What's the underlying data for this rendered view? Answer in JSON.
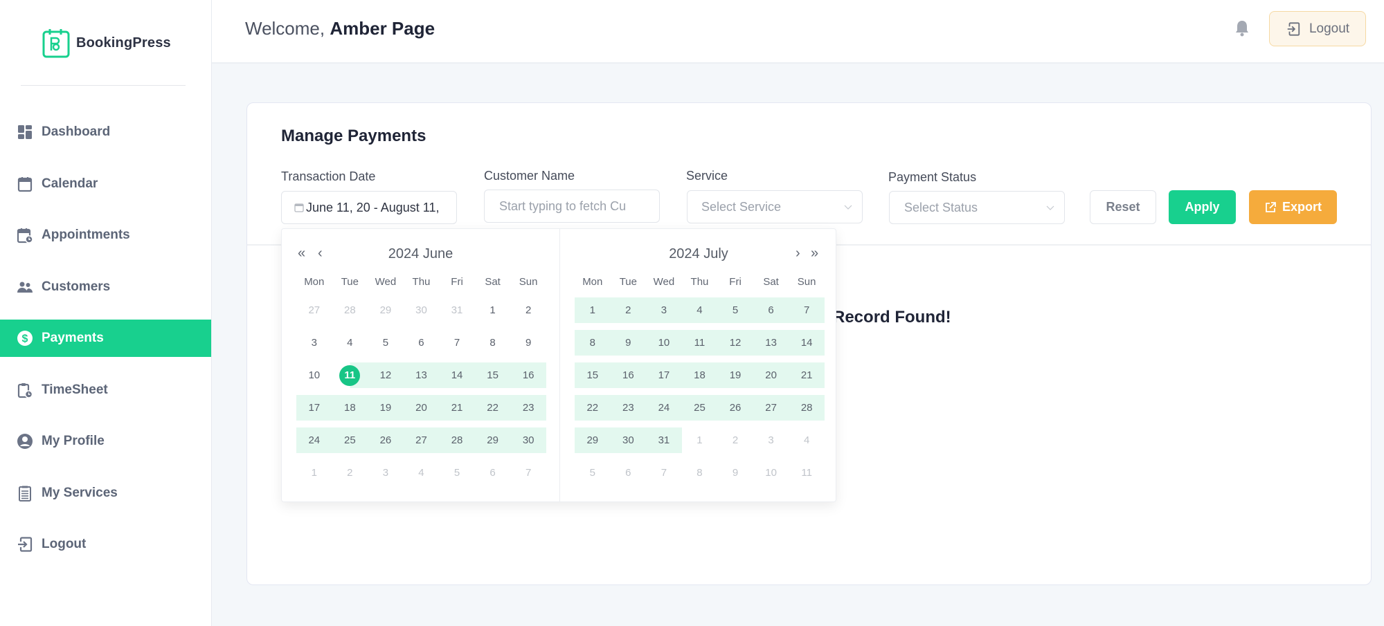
{
  "app": {
    "brand": "BookingPress"
  },
  "sidebar": {
    "items": [
      {
        "label": "Dashboard",
        "icon": "dashboard-icon",
        "active": false
      },
      {
        "label": "Calendar",
        "icon": "calendar-icon",
        "active": false
      },
      {
        "label": "Appointments",
        "icon": "appointments-icon",
        "active": false
      },
      {
        "label": "Customers",
        "icon": "customers-icon",
        "active": false
      },
      {
        "label": "Payments",
        "icon": "dollar-icon",
        "active": true
      },
      {
        "label": "TimeSheet",
        "icon": "timesheet-icon",
        "active": false
      },
      {
        "label": "My Profile",
        "icon": "user-icon",
        "active": false
      },
      {
        "label": "My Services",
        "icon": "services-icon",
        "active": false
      },
      {
        "label": "Logout",
        "icon": "logout-icon",
        "active": false
      }
    ]
  },
  "header": {
    "welcome_prefix": "Welcome,",
    "user_name": "Amber Page",
    "logout_label": "Logout"
  },
  "colors": {
    "accent": "#18d08e",
    "export": "#f5ab3c",
    "range": "#e3f8ef"
  },
  "main": {
    "title": "Manage Payments",
    "filters": {
      "transaction_date": {
        "label": "Transaction Date",
        "value": "June 11, 20 -  August 11,"
      },
      "customer_name": {
        "label": "Customer Name",
        "placeholder": "Start typing to fetch Cu"
      },
      "service": {
        "label": "Service",
        "placeholder": "Select Service"
      },
      "payment_status": {
        "label": "Payment Status",
        "placeholder": "Select Status"
      }
    },
    "buttons": {
      "reset": "Reset",
      "apply": "Apply",
      "export": "Export"
    },
    "empty_message": "Record Found!"
  },
  "datepicker": {
    "weekdays": [
      "Mon",
      "Tue",
      "Wed",
      "Thu",
      "Fri",
      "Sat",
      "Sun"
    ],
    "left": {
      "title": "2024 June",
      "weeks": [
        [
          [
            "27",
            "m"
          ],
          [
            "28",
            "m"
          ],
          [
            "29",
            "m"
          ],
          [
            "30",
            "m"
          ],
          [
            "31",
            "m"
          ],
          [
            "1",
            ""
          ],
          [
            "2",
            ""
          ]
        ],
        [
          [
            "3",
            ""
          ],
          [
            "4",
            ""
          ],
          [
            "5",
            ""
          ],
          [
            "6",
            ""
          ],
          [
            "7",
            ""
          ],
          [
            "8",
            ""
          ],
          [
            "9",
            ""
          ]
        ],
        [
          [
            "10",
            ""
          ],
          [
            "11",
            "s"
          ],
          [
            "12",
            "r"
          ],
          [
            "13",
            "r"
          ],
          [
            "14",
            "r"
          ],
          [
            "15",
            "r"
          ],
          [
            "16",
            "r"
          ]
        ],
        [
          [
            "17",
            "r"
          ],
          [
            "18",
            "r"
          ],
          [
            "19",
            "r"
          ],
          [
            "20",
            "r"
          ],
          [
            "21",
            "r"
          ],
          [
            "22",
            "r"
          ],
          [
            "23",
            "r"
          ]
        ],
        [
          [
            "24",
            "r"
          ],
          [
            "25",
            "r"
          ],
          [
            "26",
            "r"
          ],
          [
            "27",
            "r"
          ],
          [
            "28",
            "r"
          ],
          [
            "29",
            "r"
          ],
          [
            "30",
            "r"
          ]
        ],
        [
          [
            "1",
            "m"
          ],
          [
            "2",
            "m"
          ],
          [
            "3",
            "m"
          ],
          [
            "4",
            "m"
          ],
          [
            "5",
            "m"
          ],
          [
            "6",
            "m"
          ],
          [
            "7",
            "m"
          ]
        ]
      ]
    },
    "right": {
      "title": "2024 July",
      "weeks": [
        [
          [
            "1",
            "r"
          ],
          [
            "2",
            "r"
          ],
          [
            "3",
            "r"
          ],
          [
            "4",
            "r"
          ],
          [
            "5",
            "r"
          ],
          [
            "6",
            "r"
          ],
          [
            "7",
            "r"
          ]
        ],
        [
          [
            "8",
            "r"
          ],
          [
            "9",
            "r"
          ],
          [
            "10",
            "r"
          ],
          [
            "11",
            "r"
          ],
          [
            "12",
            "r"
          ],
          [
            "13",
            "r"
          ],
          [
            "14",
            "r"
          ]
        ],
        [
          [
            "15",
            "r"
          ],
          [
            "16",
            "r"
          ],
          [
            "17",
            "r"
          ],
          [
            "18",
            "r"
          ],
          [
            "19",
            "r"
          ],
          [
            "20",
            "r"
          ],
          [
            "21",
            "r"
          ]
        ],
        [
          [
            "22",
            "r"
          ],
          [
            "23",
            "r"
          ],
          [
            "24",
            "r"
          ],
          [
            "25",
            "r"
          ],
          [
            "26",
            "r"
          ],
          [
            "27",
            "r"
          ],
          [
            "28",
            "r"
          ]
        ],
        [
          [
            "29",
            "r"
          ],
          [
            "30",
            "r"
          ],
          [
            "31",
            "r"
          ],
          [
            "1",
            "m"
          ],
          [
            "2",
            "m"
          ],
          [
            "3",
            "m"
          ],
          [
            "4",
            "m"
          ]
        ],
        [
          [
            "5",
            "m"
          ],
          [
            "6",
            "m"
          ],
          [
            "7",
            "m"
          ],
          [
            "8",
            "m"
          ],
          [
            "9",
            "m"
          ],
          [
            "10",
            "m"
          ],
          [
            "11",
            "m"
          ]
        ]
      ]
    },
    "nav": {
      "prev_year": "«",
      "prev_month": "‹",
      "next_month": "›",
      "next_year": "»"
    }
  }
}
